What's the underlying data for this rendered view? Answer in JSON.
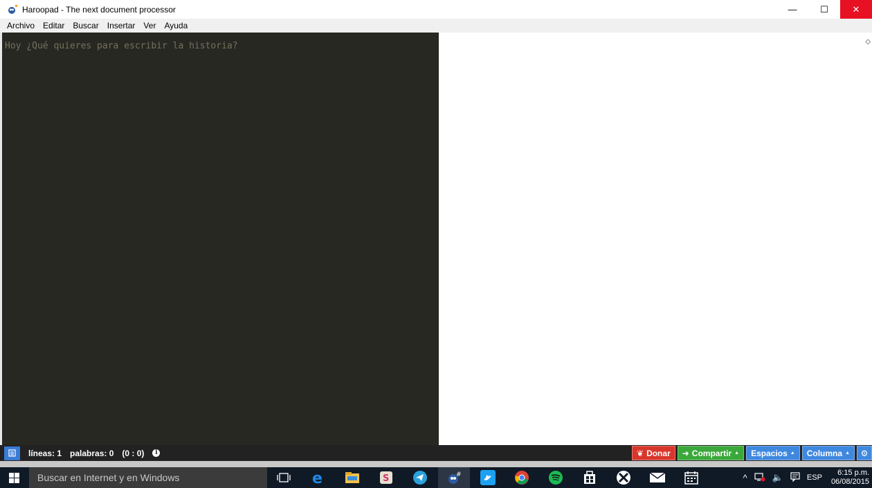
{
  "window": {
    "title": "Haroopad - The next document processor",
    "minimize_glyph": "—",
    "maximize_glyph": "☐",
    "close_glyph": "✕"
  },
  "menu": {
    "items": [
      "Archivo",
      "Editar",
      "Buscar",
      "Insertar",
      "Ver",
      "Ayuda"
    ]
  },
  "editor": {
    "placeholder": "Hoy ¿Qué quieres para escribir la historia?",
    "background": "#272822"
  },
  "statusbar": {
    "lines_label": "líneas: 1",
    "words_label": "palabras: 0",
    "position_label": "(0 : 0)",
    "donate_label": "Donar",
    "share_label": "Compartir",
    "spaces_label": "Espacios",
    "column_label": "Columna",
    "colors": {
      "donate": "#d9362b",
      "share": "#3aa83a",
      "spaces": "#3f88e0"
    }
  },
  "taskbar": {
    "search_placeholder": "Buscar en Internet y en Windows",
    "language": "ESP",
    "time": "6:15 p.m.",
    "date": "06/08/2015",
    "icons": [
      "task-view-icon",
      "edge-icon",
      "file-explorer-icon",
      "slack-icon",
      "telegram-icon",
      "haroopad-icon",
      "twitter-icon",
      "chrome-icon",
      "spotify-icon",
      "store-icon",
      "xbox-icon",
      "mail-icon",
      "calendar-icon"
    ]
  }
}
